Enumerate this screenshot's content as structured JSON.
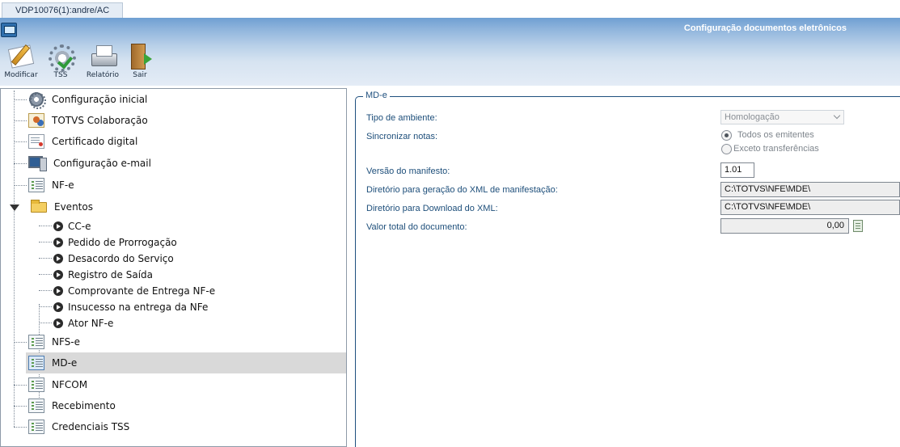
{
  "tab": {
    "label": "VDP10076(1):andre/AC"
  },
  "window": {
    "title": "Configuração documentos eletrônicos"
  },
  "toolbar": {
    "modificar": {
      "label": "Modificar",
      "icon": "pencil-paper-icon"
    },
    "tss": {
      "label": "TSS",
      "icon": "gear-check-icon"
    },
    "relatorio": {
      "label": "Relatório",
      "icon": "printer-icon"
    },
    "sair": {
      "label": "Sair",
      "icon": "exit-door-icon"
    }
  },
  "tree": {
    "items": [
      {
        "label": "Configuração inicial",
        "icon": "gear-icon"
      },
      {
        "label": "TOTVS Colaboração",
        "icon": "collaboration-icon"
      },
      {
        "label": "Certificado digital",
        "icon": "certificate-icon"
      },
      {
        "label": "Configuração e-mail",
        "icon": "computer-icon"
      },
      {
        "label": "NF-e",
        "icon": "list-icon"
      },
      {
        "label": "Eventos",
        "icon": "folder-open-icon",
        "expanded": true
      },
      {
        "label": "NFS-e",
        "icon": "list-icon"
      },
      {
        "label": "MD-e",
        "icon": "list-icon",
        "selected": true
      },
      {
        "label": "NFCOM",
        "icon": "list-icon"
      },
      {
        "label": "Recebimento",
        "icon": "list-icon"
      },
      {
        "label": "Credenciais TSS",
        "icon": "list-icon"
      }
    ],
    "eventos": [
      {
        "label": "CC-e"
      },
      {
        "label": "Pedido de Prorrogação"
      },
      {
        "label": "Desacordo do Serviço"
      },
      {
        "label": "Registro de Saída"
      },
      {
        "label": "Comprovante de Entrega NF-e"
      },
      {
        "label": "Insucesso na entrega da NFe"
      },
      {
        "label": "Ator NF-e"
      }
    ]
  },
  "form": {
    "group_title": "MD-e",
    "tipo_ambiente": {
      "label": "Tipo de ambiente:",
      "value": "Homologação"
    },
    "sincronizar": {
      "label": "Sincronizar notas:",
      "options": [
        "Todos os emitentes",
        "Exceto transferências"
      ],
      "selected": "Todos os emitentes"
    },
    "versao": {
      "label": "Versão do manifesto:",
      "value": "1.01"
    },
    "dir_geracao": {
      "label": "Diretório para geração do XML de manifestação:",
      "value": "C:\\TOTVS\\NFE\\MDE\\"
    },
    "dir_download": {
      "label": "Diretório para Download do XML:",
      "value": "C:\\TOTVS\\NFE\\MDE\\"
    },
    "valor_total": {
      "label": "Valor total do documento:",
      "value": "0,00"
    }
  },
  "colors": {
    "header_top": "#6f9fd2",
    "header_bottom": "#e4ecf6",
    "label_blue": "#1d4e7a",
    "selected_row": "#d9d9d9"
  }
}
